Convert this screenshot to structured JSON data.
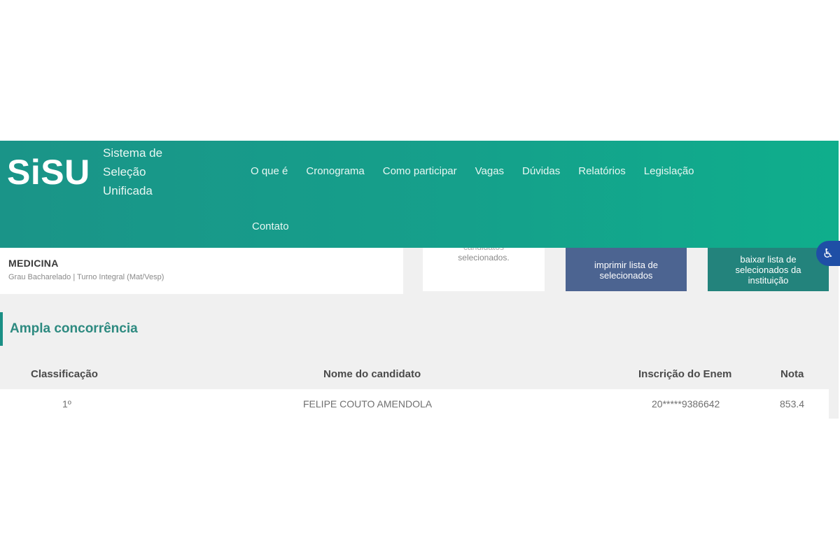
{
  "header": {
    "logo": "SiSU",
    "logo_subtitle_lines": [
      "Sistema de",
      "Seleção",
      "Unificada"
    ],
    "nav": [
      "O que é",
      "Cronograma",
      "Como participar",
      "Vagas",
      "Dúvidas",
      "Relatórios",
      "Legislação"
    ],
    "nav_second_row": "Contato",
    "colors": {
      "gradient_start": "#1a9488",
      "gradient_end": "#0fae8c"
    }
  },
  "course": {
    "title": "MEDICINA",
    "subtitle": "Grau Bacharelado | Turno Integral (Mat/Vesp)"
  },
  "info_box": {
    "line_cut": "candidatos",
    "line_main": "selecionados."
  },
  "actions": {
    "print_lines": [
      "imprimir lista de",
      "selecionados"
    ],
    "download_lines": [
      "baixar lista de",
      "selecionados da",
      "instituição"
    ],
    "accessibility_icon": "accessibility-icon",
    "colors": {
      "print": "#4c6491",
      "download": "#23837c",
      "accessibility": "#1f4fa6"
    }
  },
  "section": {
    "title": "Ampla concorrência"
  },
  "table": {
    "headers": {
      "rank": "Classificação",
      "name": "Nome do candidato",
      "enem": "Inscrição do Enem",
      "score": "Nota"
    },
    "rows": [
      {
        "rank": "1º",
        "name": "FELIPE COUTO AMENDOLA",
        "enem": "20*****9386642",
        "score": "853.4"
      }
    ]
  }
}
